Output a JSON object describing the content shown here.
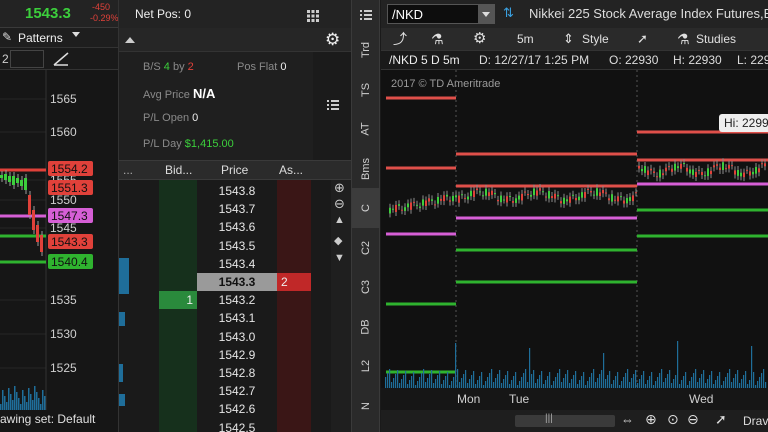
{
  "left_chart": {
    "last_price": "1543.3",
    "change": "-450",
    "change_pct": "-0.29%",
    "net_pos_label": "Net Pos: 0",
    "patterns_label": "Patterns",
    "left_partial": "2",
    "y_ticks": [
      "1565",
      "1560",
      "1555",
      "1550",
      "1545",
      "1535",
      "1530",
      "1525"
    ],
    "price_tags": [
      {
        "label": "1554.2",
        "color": "#e0413a"
      },
      {
        "label": "1551.3",
        "color": "#e0413a"
      },
      {
        "label": "1547.3",
        "color": "#d65fd6"
      },
      {
        "label": "1543.3",
        "color": "#e0413a"
      },
      {
        "label": "1540.4",
        "color": "#2fb32f"
      }
    ],
    "drawing_set_label": "awing set: Default"
  },
  "ladder": {
    "bs_label": "B/S",
    "bs_buy": "4",
    "bs_by": "by",
    "bs_sell": "2",
    "pos_flat_label": "Pos Flat",
    "pos_flat_value": "0",
    "avg_price_label": "Avg Price",
    "avg_price_value": "N/A",
    "pl_open_label": "P/L Open",
    "pl_open_value": "0",
    "pl_day_label": "P/L Day",
    "pl_day_value": "$1,415.00",
    "col_dots": "...",
    "col_bid": "Bid...",
    "col_price": "Price",
    "col_ask": "As...",
    "rows": [
      {
        "price": "1543.8",
        "bid": "",
        "ask": ""
      },
      {
        "price": "1543.7",
        "bid": "",
        "ask": ""
      },
      {
        "price": "1543.6",
        "bid": "",
        "ask": ""
      },
      {
        "price": "1543.5",
        "bid": "",
        "ask": ""
      },
      {
        "price": "1543.4",
        "bid": "",
        "ask": ""
      },
      {
        "price": "1543.3",
        "bid": "",
        "ask": "2"
      },
      {
        "price": "1543.2",
        "bid": "1",
        "ask": ""
      },
      {
        "price": "1543.1",
        "bid": "",
        "ask": ""
      },
      {
        "price": "1543.0",
        "bid": "",
        "ask": ""
      },
      {
        "price": "1542.9",
        "bid": "",
        "ask": ""
      },
      {
        "price": "1542.8",
        "bid": "",
        "ask": ""
      },
      {
        "price": "1542.7",
        "bid": "",
        "ask": ""
      },
      {
        "price": "1542.6",
        "bid": "",
        "ask": ""
      },
      {
        "price": "1542.5",
        "bid": "",
        "ask": ""
      }
    ]
  },
  "side_tabs": [
    "Trd",
    "TS",
    "AT",
    "Bms",
    "C",
    "C2",
    "C3",
    "DB",
    "L2",
    "N"
  ],
  "right_chart": {
    "symbol": "/NKD",
    "description": "Nikkei 225 Stock Average Index Futures,E",
    "interval": "5m",
    "style_label": "Style",
    "studies_label": "Studies",
    "info_symbol": "/NKD 5 D 5m",
    "info_date": "D: 12/27/17 1:25 PM",
    "info_open": "O: 22930",
    "info_high": "H: 22930",
    "info_low": "L: 229",
    "copyright": "2017 © TD Ameritrade",
    "hi_label": "Hi: 2299",
    "x_labels": [
      "Mon",
      "Tue",
      "Wed"
    ],
    "draw_partial": "Drav"
  }
}
